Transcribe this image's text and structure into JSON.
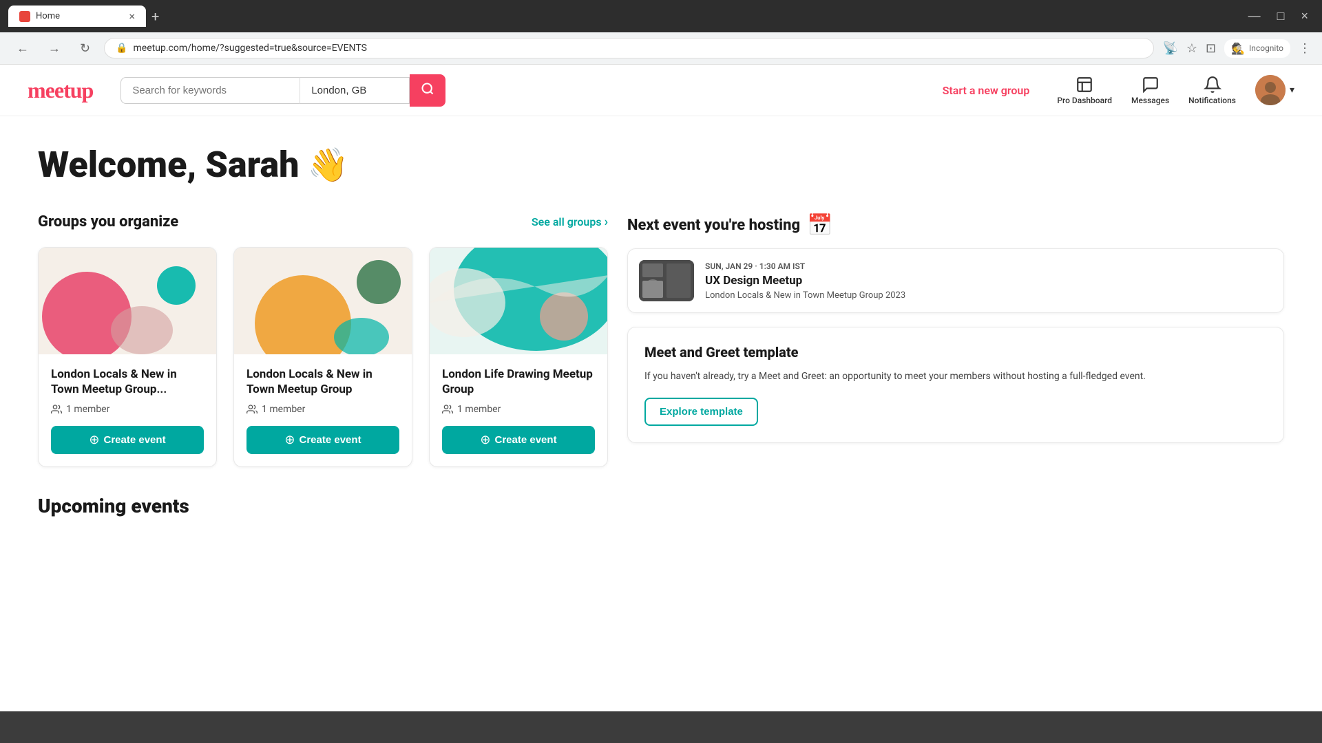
{
  "browser": {
    "tab_title": "Home",
    "tab_close": "×",
    "new_tab": "+",
    "address": "meetup.com/home/?suggested=true&source=EVENTS",
    "back": "←",
    "forward": "→",
    "refresh": "↻",
    "incognito_label": "Incognito",
    "window_minimize": "—",
    "window_maximize": "□",
    "window_close": "×"
  },
  "header": {
    "logo": "meetup",
    "search_placeholder": "Search for keywords",
    "location_value": "London, GB",
    "start_new_group": "Start a new group",
    "pro_dashboard": "Pro Dashboard",
    "messages": "Messages",
    "notifications": "Notifications",
    "chevron_down": "▾"
  },
  "main": {
    "welcome": "Welcome, Sarah",
    "wave_emoji": "👋",
    "groups_title": "Groups you organize",
    "see_all_groups": "See all groups",
    "see_all_arrow": "›",
    "groups": [
      {
        "name": "London Locals & New in Town Meetup Group...",
        "members": "1 member",
        "create_event_label": "Create event"
      },
      {
        "name": "London Locals & New in Town Meetup Group",
        "members": "1 member",
        "create_event_label": "Create event"
      },
      {
        "name": "London Life Drawing Meetup Group",
        "members": "1 member",
        "create_event_label": "Create event"
      }
    ],
    "next_event_title": "Next event you're hosting",
    "next_event": {
      "date": "SUN, JAN 29 · 1:30 AM IST",
      "name": "UX Design Meetup",
      "group": "London Locals & New in Town Meetup Group 2023"
    },
    "template_title": "Meet and Greet template",
    "template_desc": "If you haven't already, try a Meet and Greet: an opportunity to meet your members without hosting a full-fledged event.",
    "explore_template": "Explore template",
    "upcoming_events": "Upcoming events"
  }
}
